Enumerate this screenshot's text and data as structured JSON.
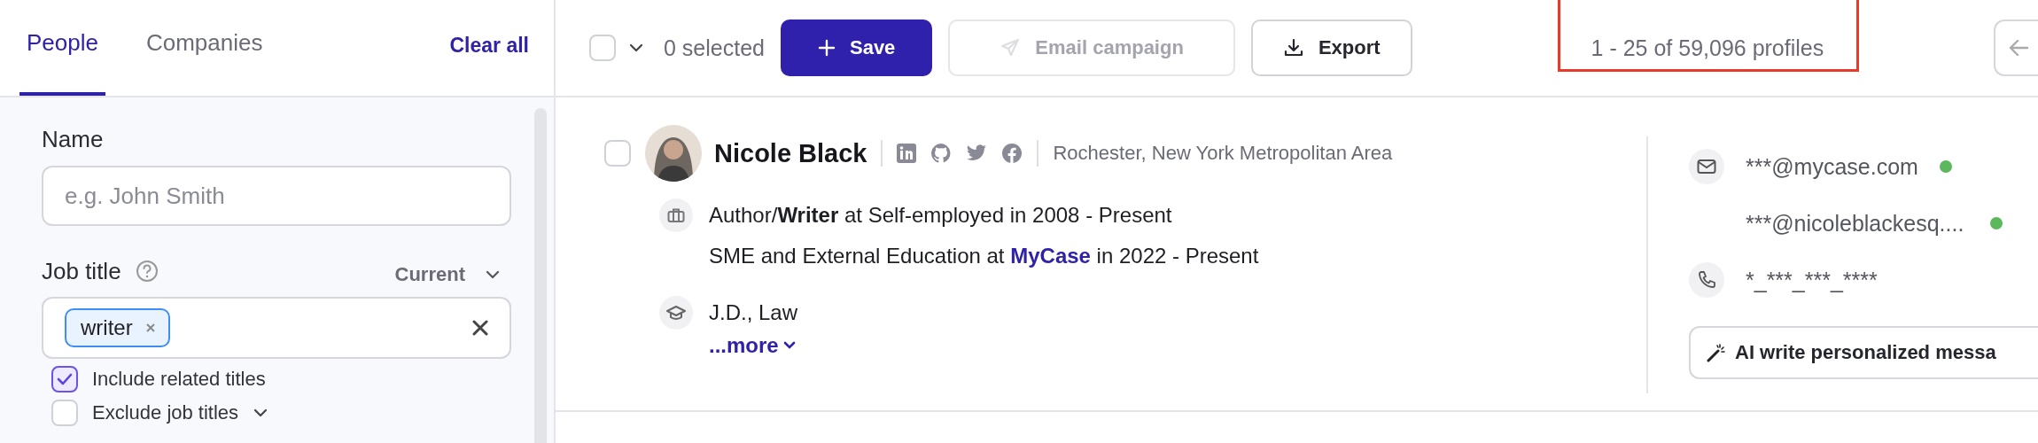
{
  "sidebar": {
    "tabs": [
      {
        "label": "People",
        "selected": true
      },
      {
        "label": "Companies",
        "selected": false
      }
    ],
    "clear_all": "Clear all",
    "name_filter": {
      "label": "Name",
      "placeholder": "e.g. John Smith"
    },
    "job_title_filter": {
      "label": "Job title",
      "scope": "Current",
      "tags": [
        {
          "label": "writer"
        }
      ],
      "options": [
        {
          "label": "Include related titles",
          "checked": true,
          "dropdown": false
        },
        {
          "label": "Exclude job titles",
          "checked": false,
          "dropdown": true
        }
      ]
    }
  },
  "toolbar": {
    "select_all_checked": false,
    "selected_count": "0 selected",
    "buttons": [
      {
        "label": "Save",
        "kind": "primary"
      },
      {
        "label": "Email campaign",
        "kind": "disabled"
      },
      {
        "label": "Export",
        "kind": "outline"
      }
    ],
    "results_count": "1 - 25 of 59,096 profiles"
  },
  "profiles": [
    {
      "checked": false,
      "name": "Nicole Black",
      "location": "Rochester, New York Metropolitan Area",
      "experience": [
        {
          "text": "Author/**Writer** at Self-employed in 2008 - Present"
        },
        {
          "prefix": "SME and External Education at ",
          "company": "MyCase",
          "suffix": " in 2022 - Present"
        }
      ],
      "education": "J.D., Law",
      "more": "...more",
      "emails": [
        {
          "value": "***@mycase.com",
          "color": "#5cb85c"
        },
        {
          "value": "***@nicoleblackesq....",
          "color": "#5cb85c"
        }
      ],
      "phone": "*_***_***_****",
      "ai_button": "AI write personalized messa"
    }
  ]
}
